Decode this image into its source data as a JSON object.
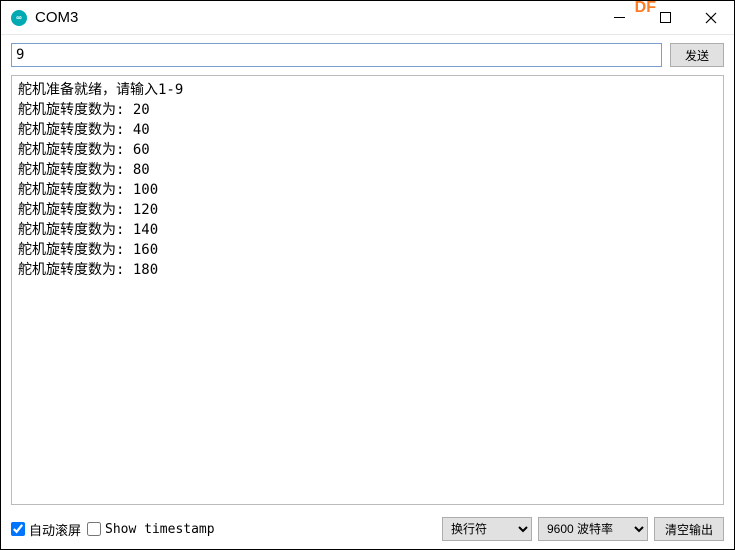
{
  "window": {
    "title": "COM3",
    "icon_label": "∞",
    "watermark": "DF"
  },
  "input": {
    "value": "9"
  },
  "buttons": {
    "send": "发送",
    "clear": "清空输出"
  },
  "output": {
    "header_line": "舵机准备就绪，请输入1-9",
    "prefix": "舵机旋转度数为: ",
    "values": [
      20,
      40,
      60,
      80,
      100,
      120,
      140,
      160,
      180
    ]
  },
  "bottom": {
    "autoscroll": {
      "label": "自动滚屏",
      "checked": true
    },
    "timestamp": {
      "label": "Show timestamp",
      "checked": false
    },
    "line_ending": {
      "selected": "换行符"
    },
    "baud": {
      "selected": "9600 波特率"
    }
  }
}
